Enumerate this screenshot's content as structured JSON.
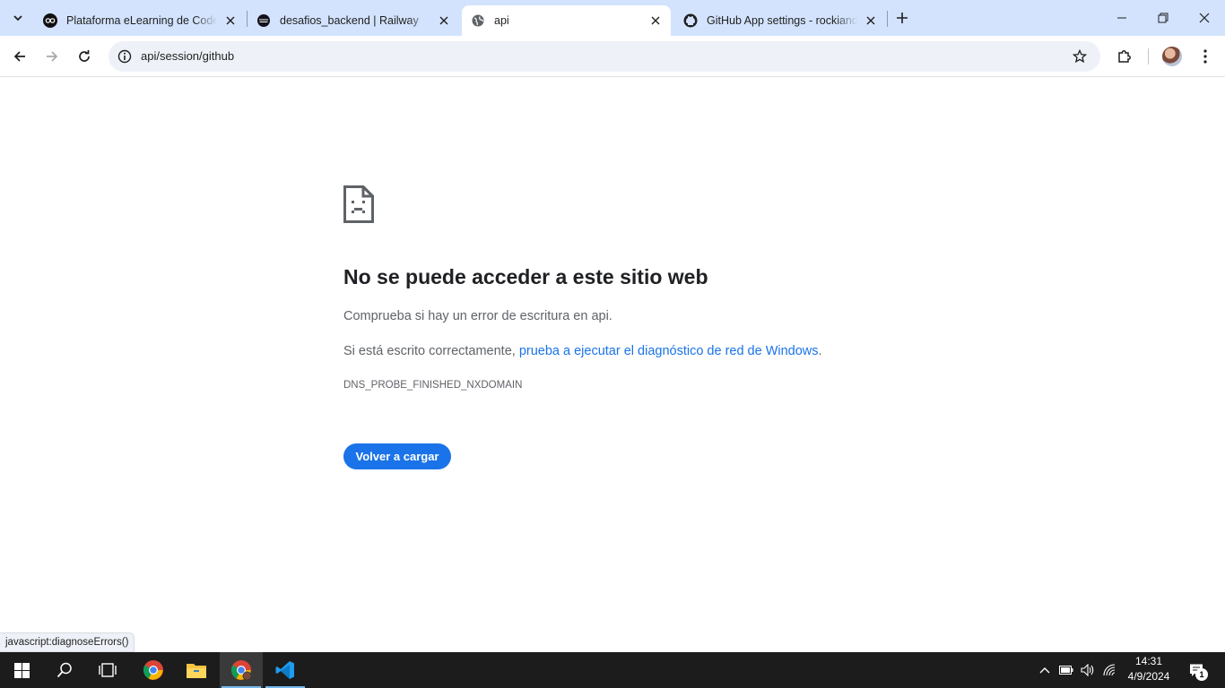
{
  "browser": {
    "tabs": [
      {
        "title": "Plataforma eLearning de Coderhouse",
        "favicon": "coderhouse-icon",
        "active": false
      },
      {
        "title": "desafios_backend | Railway",
        "favicon": "railway-icon",
        "active": false
      },
      {
        "title": "api",
        "favicon": "globe-icon",
        "active": true
      },
      {
        "title": "GitHub App settings - rockiando",
        "favicon": "github-icon",
        "active": false
      }
    ],
    "address": "api/session/github"
  },
  "error_page": {
    "title": "No se puede acceder a este sitio web",
    "line1": "Comprueba si hay un error de escritura en api.",
    "line2_prefix": "Si está escrito correctamente, ",
    "line2_link": "prueba a ejecutar el diagnóstico de red de Windows",
    "line2_suffix": ".",
    "error_code": "DNS_PROBE_FINISHED_NXDOMAIN",
    "reload_button": "Volver a cargar"
  },
  "status_bar": "javascript:diagnoseErrors()",
  "taskbar": {
    "time": "14:31",
    "date": "4/9/2024",
    "notification_count": "1"
  },
  "colors": {
    "tab_strip": "#d3e3fd",
    "accent": "#1a73e8",
    "taskbar": "#1c1c1c"
  }
}
